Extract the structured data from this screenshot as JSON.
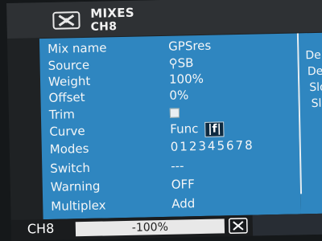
{
  "header": {
    "title": "MIXES",
    "subtitle": "CH8"
  },
  "fields": [
    {
      "label": "Mix name",
      "value": "GPSres"
    },
    {
      "label": "Source",
      "value": "SB",
      "icon": "switch-icon"
    },
    {
      "label": "Weight",
      "value": "100%"
    },
    {
      "label": "Offset",
      "value": "0%"
    },
    {
      "label": "Trim",
      "checkbox": true
    },
    {
      "label": "Curve",
      "value": "Func",
      "badge": "|f|"
    },
    {
      "label": "Modes",
      "value": "012345678"
    },
    {
      "label": "Switch",
      "value": "---"
    },
    {
      "label": "Warning",
      "value": "OFF"
    },
    {
      "label": "Multiplex",
      "value": "Add"
    }
  ],
  "rightpanel": {
    "items": [
      "Dela",
      "Dela",
      "Slo",
      "Slo"
    ]
  },
  "footer": {
    "channel": "CH8",
    "bar_text": "-100%",
    "bar_value": -100
  },
  "colors": {
    "main_bg": "#2f86c0",
    "header_bg": "#2e3134",
    "text": "#f4f6f7"
  }
}
